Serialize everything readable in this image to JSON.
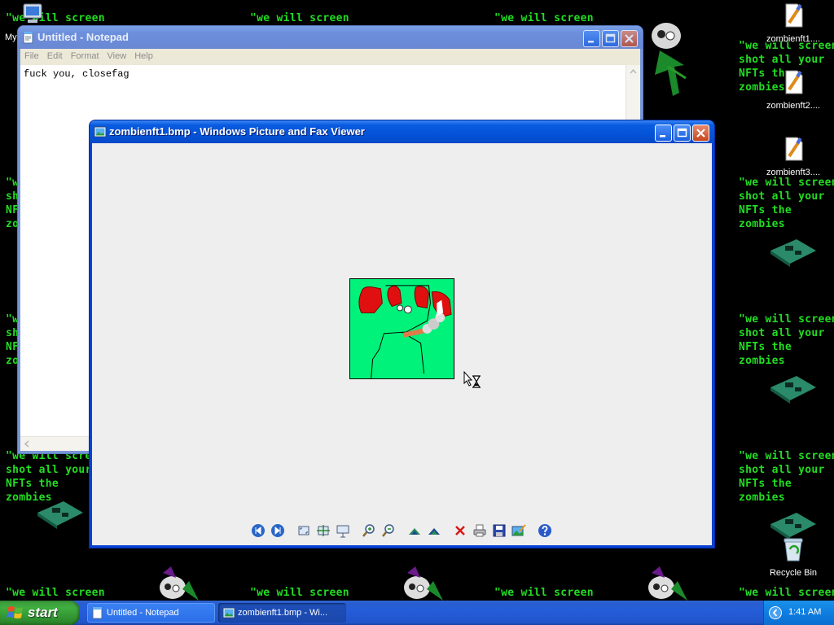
{
  "wallpaper": {
    "caption_lines": [
      "\"we will screen",
      "shot all your",
      "NFTs the",
      "zombies"
    ]
  },
  "desktop_icons": [
    {
      "label": "My",
      "icon": "my-computer-icon"
    },
    {
      "label": "zombienft1....",
      "icon": "bitmap-file-icon"
    },
    {
      "label": "zombienft2....",
      "icon": "bitmap-file-icon"
    },
    {
      "label": "zombienft3....",
      "icon": "bitmap-file-icon"
    },
    {
      "label": "Recycle Bin",
      "icon": "recycle-bin-icon"
    }
  ],
  "notepad": {
    "title": "Untitled - Notepad",
    "menu": [
      "File",
      "Edit",
      "Format",
      "View",
      "Help"
    ],
    "content": "fuck you, closefag"
  },
  "viewer": {
    "title": "zombienft1.bmp - Windows Picture and Fax Viewer",
    "image_name": "zombienft1.bmp",
    "toolbar_icons": [
      "previous-image-icon",
      "next-image-icon",
      "best-fit-icon",
      "actual-size-icon",
      "slideshow-icon",
      "zoom-in-icon",
      "zoom-out-icon",
      "rotate-clockwise-icon",
      "rotate-counterclockwise-icon",
      "delete-icon",
      "print-icon",
      "save-icon",
      "edit-icon",
      "help-icon"
    ]
  },
  "taskbar": {
    "start_label": "start",
    "buttons": [
      {
        "label": "Untitled - Notepad",
        "active": false
      },
      {
        "label": "zombienft1.bmp - Wi...",
        "active": true
      }
    ],
    "clock": "1:41 AM"
  },
  "colors": {
    "wallpaper_text": "#22dd22",
    "titlebar_active": "#0453d8",
    "taskbar": "#245dd8",
    "start_button": "#3fae3f",
    "nft_background": "#00f27a",
    "nft_red": "#e01010"
  }
}
